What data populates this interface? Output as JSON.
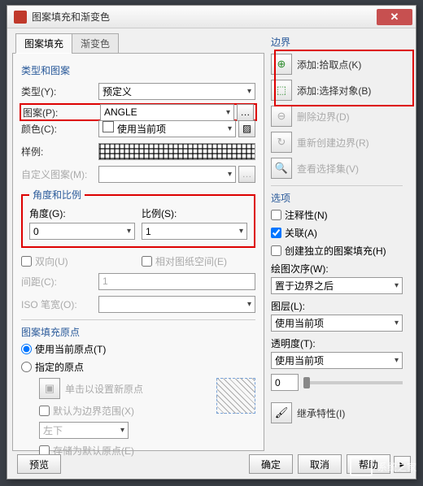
{
  "window": {
    "title": "图案填充和渐变色"
  },
  "tabs": {
    "active": "图案填充",
    "inactive": "渐变色"
  },
  "typePattern": {
    "title": "类型和图案",
    "typeLabel": "类型(Y):",
    "typeValue": "预定义",
    "patternLabel": "图案(P):",
    "patternValue": "ANGLE",
    "colorLabel": "颜色(C):",
    "colorValue": "使用当前项",
    "sampleLabel": "样例:",
    "customLabel": "自定义图案(M):"
  },
  "angleScale": {
    "legend": "角度和比例",
    "angleLabel": "角度(G):",
    "angleValue": "0",
    "scaleLabel": "比例(S):",
    "scaleValue": "1",
    "twoWay": "双向(U)",
    "relPaper": "相对图纸空间(E)",
    "spacingLabel": "间距(C):",
    "spacingValue": "1",
    "isoLabel": "ISO 笔宽(O):"
  },
  "origin": {
    "title": "图案填充原点",
    "useCurrent": "使用当前原点(T)",
    "specified": "指定的原点",
    "clickSet": "单击以设置新原点",
    "defaultBoundary": "默认为边界范围(X)",
    "posValue": "左下",
    "storeDefault": "存储为默认原点(E)"
  },
  "boundary": {
    "title": "边界",
    "addPick": "添加:拾取点(K)",
    "addSelect": "添加:选择对象(B)",
    "removeBoundary": "删除边界(D)",
    "recreateBoundary": "重新创建边界(R)",
    "viewSelection": "查看选择集(V)"
  },
  "options": {
    "title": "选项",
    "annotative": "注释性(N)",
    "associative": "关联(A)",
    "independent": "创建独立的图案填充(H)",
    "drawOrderLabel": "绘图次序(W):",
    "drawOrderValue": "置于边界之后",
    "layerLabel": "图层(L):",
    "layerValue": "使用当前项",
    "transparencyLabel": "透明度(T):",
    "transparencyValue": "使用当前项",
    "transparencyNum": "0",
    "inherit": "继承特性(I)"
  },
  "footer": {
    "preview": "预览",
    "ok": "确定",
    "cancel": "取消",
    "help": "帮助"
  },
  "watermark": "系统之家"
}
